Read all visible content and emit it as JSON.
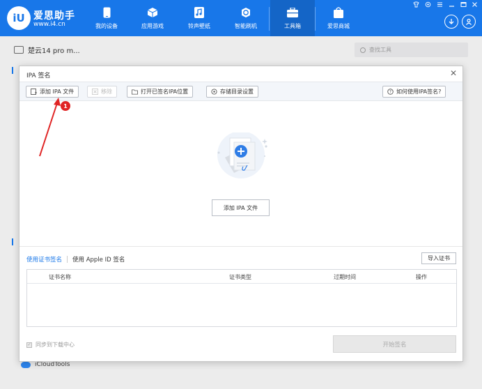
{
  "app": {
    "brand": "爱思助手",
    "url": "www.i4.cn",
    "logo_text": "iU"
  },
  "nav": [
    {
      "label": "我的设备",
      "icon": "phone-icon"
    },
    {
      "label": "应用游戏",
      "icon": "cube-icon"
    },
    {
      "label": "铃声壁纸",
      "icon": "music-icon"
    },
    {
      "label": "智能刷机",
      "icon": "refresh-icon"
    },
    {
      "label": "工具箱",
      "icon": "toolbox-icon",
      "active": true
    },
    {
      "label": "爱思商城",
      "icon": "shopping-bag-icon"
    }
  ],
  "background": {
    "device_name": "楚云14 pro m...",
    "search_placeholder": "查找工具",
    "icloud_label": "iCloudTools"
  },
  "dialog": {
    "title": "IPA 签名",
    "close": "✕",
    "toolbar": {
      "add_ipa": "添加 IPA 文件",
      "remove": "移除",
      "open_signed": "打开已签名IPA位置",
      "storage_settings": "存储目录设置",
      "help": "如何使用IPA签名?"
    },
    "add_ipa_center": "添加 IPA 文件",
    "tabs": {
      "cert_sign": "使用证书签名",
      "apple_id_sign": "使用 Apple ID 签名"
    },
    "import_cert": "导入证书",
    "table_headers": [
      "证书名称",
      "证书类型",
      "过期时间",
      "操作"
    ],
    "sync_label": "同步到下载中心",
    "start_sign": "开始签名"
  },
  "annotation": {
    "badge": "1"
  },
  "colors": {
    "primary": "#1877e9",
    "badge": "#e02424"
  }
}
